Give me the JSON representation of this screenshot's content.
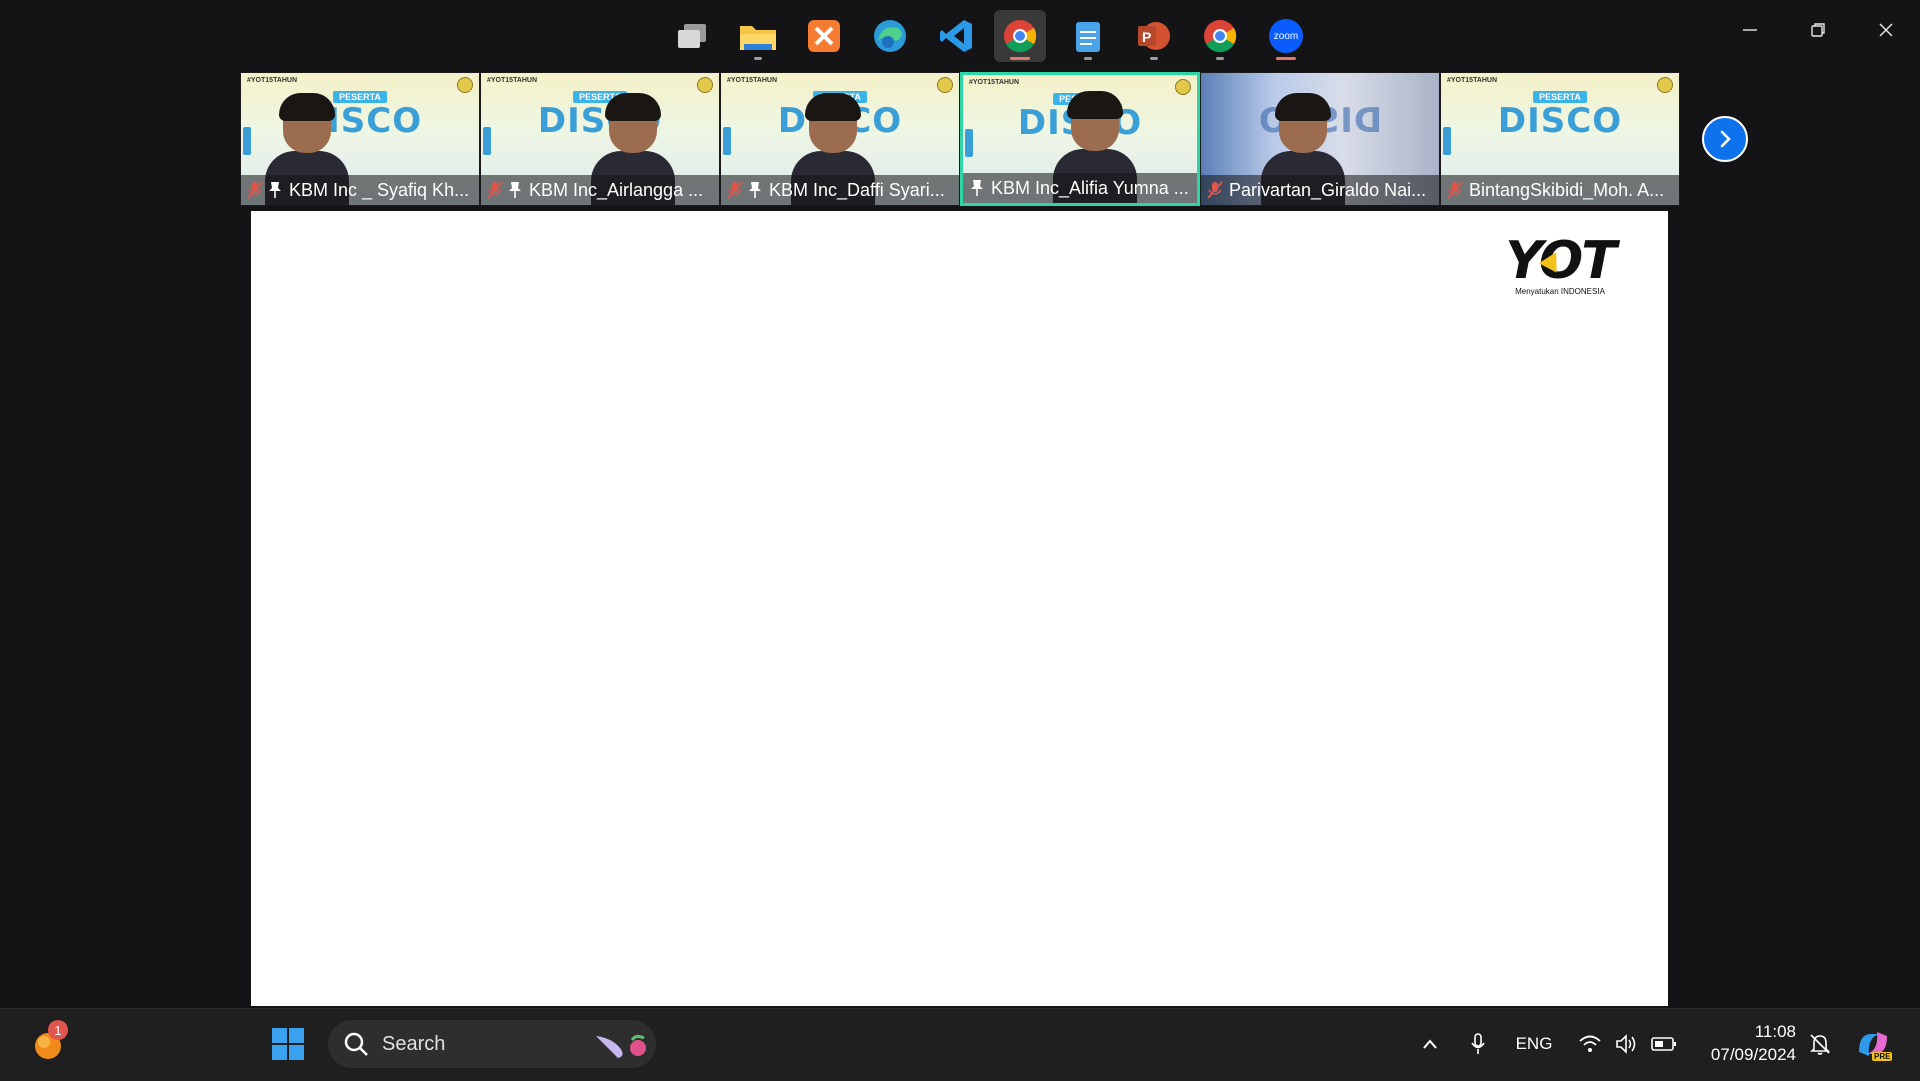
{
  "window": {
    "controls": [
      "minimize",
      "restore",
      "close"
    ]
  },
  "participants": [
    {
      "name": "KBM Inc _ Syafiq Kh...",
      "muted": true,
      "pinned": true,
      "active": false
    },
    {
      "name": "KBM Inc_Airlangga ...",
      "muted": true,
      "pinned": true,
      "active": false
    },
    {
      "name": "KBM Inc_Daffi Syari...",
      "muted": true,
      "pinned": true,
      "active": false
    },
    {
      "name": "KBM Inc_Alifia Yumna ...",
      "muted": false,
      "pinned": true,
      "active": true
    },
    {
      "name": "Parivartan_Giraldo Nai...",
      "muted": true,
      "pinned": false,
      "active": false
    },
    {
      "name": "BintangSkibidi_Moh. A...",
      "muted": true,
      "pinned": false,
      "active": false
    }
  ],
  "background": {
    "hashtag": "#YOT15TAHUN",
    "badge": "PESERTA",
    "title": "DISCO"
  },
  "share": {
    "logo_text": "YOT",
    "logo_tagline": "Menyatukan INDONESIA"
  },
  "taskbar": {
    "notification_count": "1",
    "search_placeholder": "Search",
    "apps": [
      "start",
      "task-view",
      "file-explorer",
      "xampp",
      "edge",
      "vscode",
      "chrome",
      "notepad",
      "powerpoint",
      "chrome-profile",
      "zoom"
    ],
    "zoom_label": "zoom",
    "language": "ENG",
    "time": "11:08",
    "date": "07/09/2024",
    "copilot_label": "PRE"
  },
  "colors": {
    "accent": "#0e72ed",
    "active_border": "#2ed6a6",
    "mute_red": "#e0564c",
    "background": "#141416"
  }
}
